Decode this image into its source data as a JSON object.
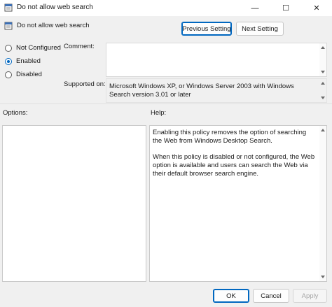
{
  "window": {
    "title": "Do not allow web search",
    "minimize_glyph": "—",
    "maximize_glyph": "☐",
    "close_glyph": "✕"
  },
  "header": {
    "policy_name": "Do not allow web search",
    "previous_label": "Previous Setting",
    "next_label": "Next Setting"
  },
  "state": {
    "options": [
      {
        "label": "Not Configured",
        "checked": false
      },
      {
        "label": "Enabled",
        "checked": true
      },
      {
        "label": "Disabled",
        "checked": false
      }
    ]
  },
  "comment": {
    "label": "Comment:",
    "value": ""
  },
  "supported": {
    "label": "Supported on:",
    "value": "Microsoft Windows XP, or Windows Server 2003 with Windows Search version 3.01 or later"
  },
  "options_pane": {
    "label": "Options:"
  },
  "help_pane": {
    "label": "Help:",
    "paragraphs": [
      "Enabling this policy removes the option of searching the Web from Windows Desktop Search.",
      "When this policy is disabled or not configured, the Web option is available and users can search the Web via their default browser search engine."
    ]
  },
  "footer": {
    "ok_label": "OK",
    "cancel_label": "Cancel",
    "apply_label": "Apply"
  },
  "colors": {
    "accent": "#0067c0",
    "background": "#f0f0f0"
  },
  "icons": {
    "title": "policy-document-icon",
    "header": "policy-document-icon"
  }
}
